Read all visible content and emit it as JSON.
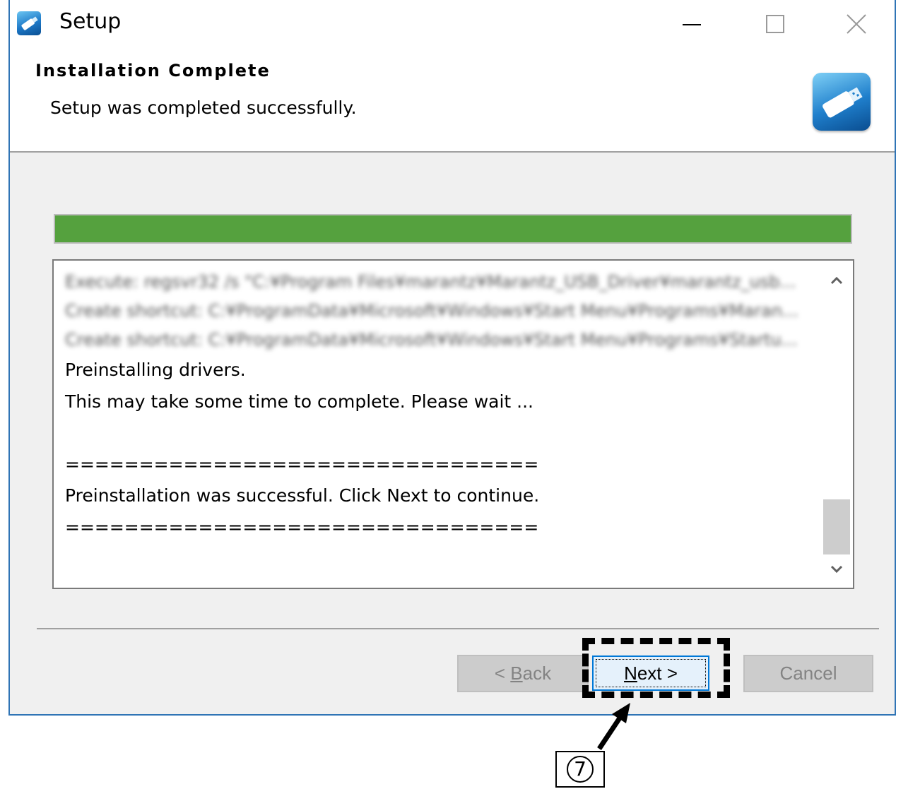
{
  "window": {
    "title": "Setup",
    "controls": {
      "minimize": "minimize-icon",
      "maximize": "maximize-icon",
      "close": "close-icon"
    }
  },
  "header": {
    "title": "Installation Complete",
    "subtitle": "Setup was completed successfully."
  },
  "progress": {
    "value": 1.0,
    "color": "#55a13e"
  },
  "log": {
    "blurred_lines": [
      "Execute: regsvr32 /s \"C:¥Program Files¥marantz¥Marantz_USB_Driver¥marantz_usb...",
      "Create shortcut: C:¥ProgramData¥Microsoft¥Windows¥Start Menu¥Programs¥Maran...",
      "Create shortcut: C:¥ProgramData¥Microsoft¥Windows¥Start Menu¥Programs¥Startu..."
    ],
    "line1": "Preinstalling drivers.",
    "line2": "This may take some time to complete. Please wait ...",
    "separator1": "================================",
    "line3": "Preinstallation was successful. Click Next to continue.",
    "separator2": "================================"
  },
  "buttons": {
    "back_prefix": "< ",
    "back_accel": "B",
    "back_rest": "ack",
    "next_accel": "N",
    "next_rest": "ext >",
    "cancel": "Cancel"
  },
  "annotation": {
    "step_number": "7"
  },
  "colors": {
    "accent": "#0078d7",
    "window_border": "#2f74b5",
    "progress": "#55a13e"
  }
}
